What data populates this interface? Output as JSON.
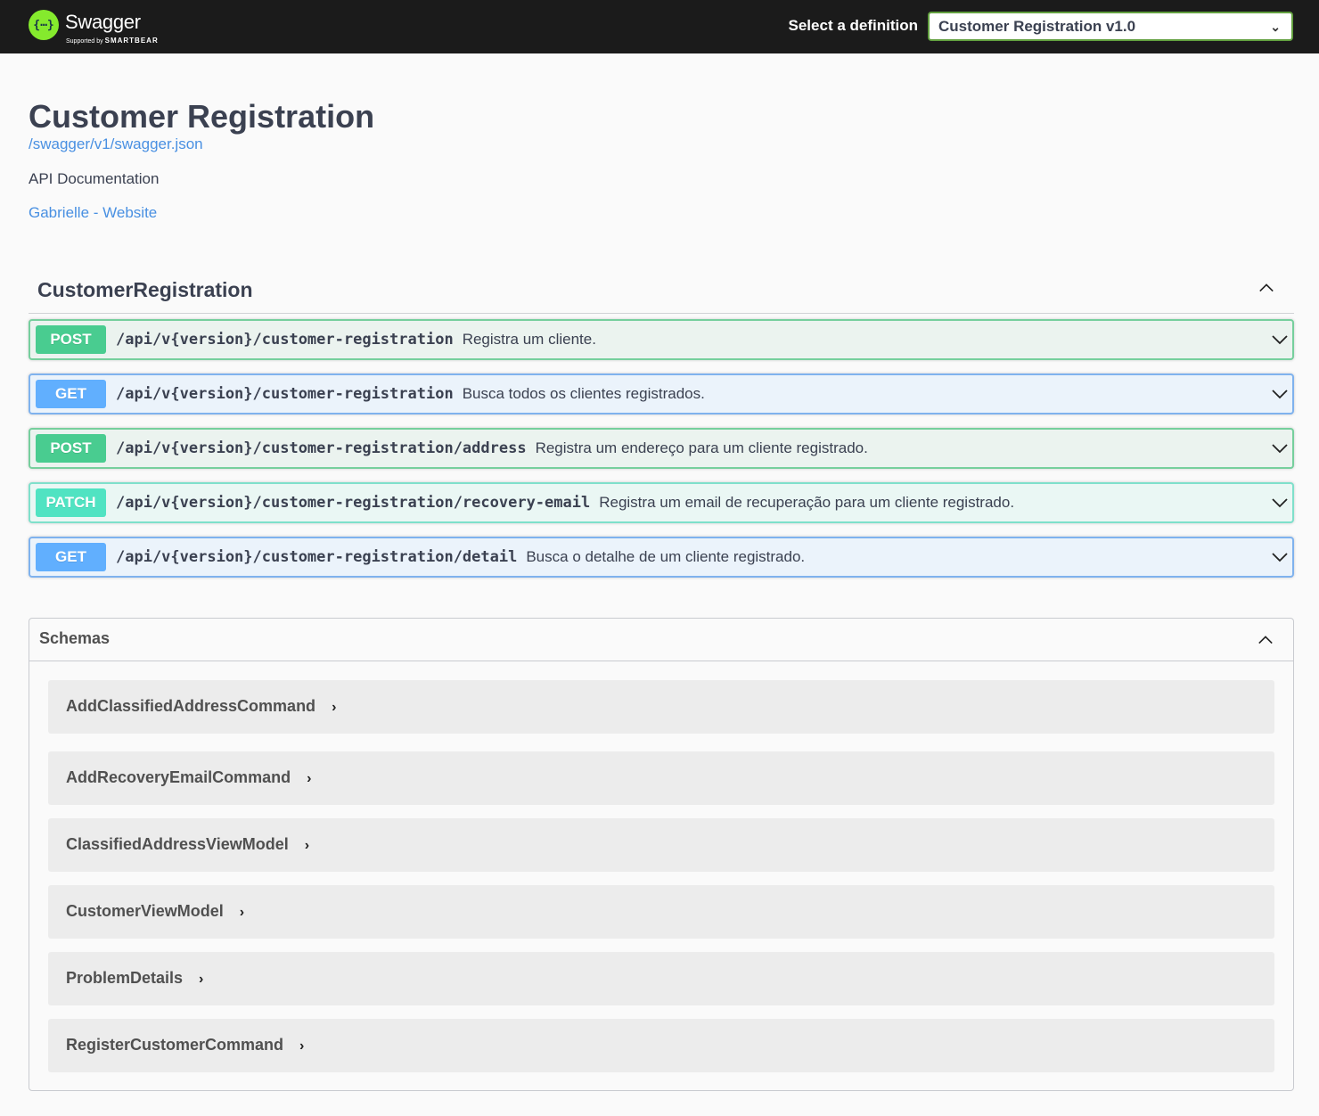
{
  "topbar": {
    "logo_name": "Swagger",
    "logo_sub_prefix": "Supported by",
    "logo_sub_brand": "SMARTBEAR",
    "definition_label": "Select a definition",
    "definition_value": "Customer Registration v1.0"
  },
  "info": {
    "title": "Customer Registration",
    "spec_url": "/swagger/v1/swagger.json",
    "description": "API Documentation",
    "contact": "Gabrielle - Website"
  },
  "tag": {
    "name": "CustomerRegistration",
    "operations": [
      {
        "method": "POST",
        "path": "/api/v{version}/customer-registration",
        "summary": "Registra um cliente."
      },
      {
        "method": "GET",
        "path": "/api/v{version}/customer-registration",
        "summary": "Busca todos os clientes registrados."
      },
      {
        "method": "POST",
        "path": "/api/v{version}/customer-registration/address",
        "summary": "Registra um endereço para um cliente registrado."
      },
      {
        "method": "PATCH",
        "path": "/api/v{version}/customer-registration/recovery-email",
        "summary": "Registra um email de recuperação para um cliente registrado."
      },
      {
        "method": "GET",
        "path": "/api/v{version}/customer-registration/detail",
        "summary": "Busca o detalhe de um cliente registrado."
      }
    ]
  },
  "schemas": {
    "title": "Schemas",
    "models": [
      "AddClassifiedAddressCommand",
      "AddRecoveryEmailCommand",
      "ClassifiedAddressViewModel",
      "CustomerViewModel",
      "ProblemDetails",
      "RegisterCustomerCommand"
    ]
  },
  "colors": {
    "post": "#49cc90",
    "get": "#61affe",
    "patch": "#50e3c2",
    "link": "#4990e2",
    "topbar": "#1b1b1b"
  }
}
